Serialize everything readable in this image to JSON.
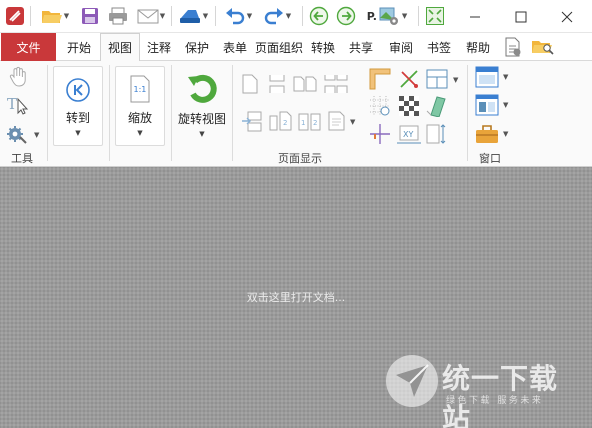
{
  "titlebar": {
    "quick_access_icons": [
      "app-logo-icon",
      "open-folder-icon",
      "save-icon",
      "print-icon",
      "email-icon",
      "scan-icon",
      "undo-icon",
      "redo-icon",
      "back-icon",
      "forward-icon",
      "p-tools-icon",
      "fullscreen-icon"
    ],
    "p_label": "P."
  },
  "tabs": {
    "file": "文件",
    "items": [
      "开始",
      "视图",
      "注释",
      "保护",
      "表单",
      "页面组织",
      "转换",
      "共享",
      "审阅",
      "书签",
      "帮助"
    ],
    "active": "视图"
  },
  "ribbon": {
    "tools_group_label": "工具",
    "goto_label": "转到",
    "zoom_label": "缩放",
    "zoom_icon_text": "1:1",
    "rotate_label": "旋转视图",
    "page_display_label": "页面显示",
    "window_label": "窗口"
  },
  "document": {
    "hint": "双击这里打开文档..."
  },
  "watermark": {
    "title": "统一下载站",
    "subtitle": "绿色下载 服务未来"
  },
  "colors": {
    "file_tab": "#c9383a",
    "accent_blue": "#3a7fd1",
    "accent_green": "#4fa83d",
    "doc_bg": "#9b9b9b"
  }
}
